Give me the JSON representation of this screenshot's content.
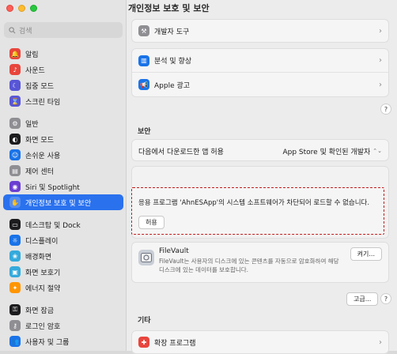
{
  "window": {
    "title": "개인정보 보호 및 보안"
  },
  "search": {
    "placeholder": "검색"
  },
  "sidebar": {
    "items": [
      {
        "label": "알림",
        "icon": "bell-icon",
        "color": "#e8453c",
        "glyph": "🔔"
      },
      {
        "label": "사운드",
        "icon": "speaker-icon",
        "color": "#e8453c",
        "glyph": "♪"
      },
      {
        "label": "집중 모드",
        "icon": "moon-icon",
        "color": "#5856d6",
        "glyph": "☾"
      },
      {
        "label": "스크린 타임",
        "icon": "hourglass-icon",
        "color": "#5856d6",
        "glyph": "⌛"
      },
      {
        "label": "일반",
        "icon": "gear-icon",
        "color": "#8e8e93",
        "glyph": "⚙"
      },
      {
        "label": "화면 모드",
        "icon": "appearance-icon",
        "color": "#1c1c1e",
        "glyph": "◐"
      },
      {
        "label": "손쉬운 사용",
        "icon": "accessibility-icon",
        "color": "#1a73e8",
        "glyph": "☺"
      },
      {
        "label": "제어 센터",
        "icon": "control-center-icon",
        "color": "#8e8e93",
        "glyph": "▤"
      },
      {
        "label": "Siri 및 Spotlight",
        "icon": "siri-icon",
        "color": "#6a3ed1",
        "glyph": "◉"
      },
      {
        "label": "개인정보 보호 및 보안",
        "icon": "hand-icon",
        "color": "#2a71ee",
        "glyph": "✋"
      },
      {
        "label": "데스크탑 및 Dock",
        "icon": "dock-icon",
        "color": "#1c1c1e",
        "glyph": "▭"
      },
      {
        "label": "디스플레이",
        "icon": "display-icon",
        "color": "#1a73e8",
        "glyph": "☼"
      },
      {
        "label": "배경화면",
        "icon": "wallpaper-icon",
        "color": "#34aadc",
        "glyph": "❀"
      },
      {
        "label": "화면 보호기",
        "icon": "screensaver-icon",
        "color": "#34aadc",
        "glyph": "▣"
      },
      {
        "label": "에너지 절약",
        "icon": "lightbulb-icon",
        "color": "#ff9500",
        "glyph": "✦"
      },
      {
        "label": "화면 잠금",
        "icon": "lock-screen-icon",
        "color": "#1c1c1e",
        "glyph": "⚿"
      },
      {
        "label": "로그인 암호",
        "icon": "login-password-icon",
        "color": "#8e8e93",
        "glyph": "⚷"
      },
      {
        "label": "사용자 및 그룹",
        "icon": "users-icon",
        "color": "#1a73e8",
        "glyph": "👥"
      }
    ]
  },
  "rows": {
    "developer_tools": "개발자 도구",
    "analytics": "분석 및 향상",
    "apple_ads": "Apple 광고"
  },
  "security": {
    "section_title": "보안",
    "allow_label": "다음에서 다운로드한 앱 허용",
    "allow_value": "App Store 및 확인된 개발자",
    "blocked_message": "응용 프로그램 'AhnESApp'의 시스템 소프트웨어가 차단되어 로드할 수 없습니다.",
    "allow_button": "허용",
    "filevault_title": "FileVault",
    "filevault_desc_1": "FileVault는 사용자의 디스크에 있는 콘텐츠를 자동으로 암호화하여 해당",
    "filevault_desc_2": "디스크에 있는 데이터를 보호합니다.",
    "turn_on_button": "켜기...",
    "advanced_button": "고급..."
  },
  "other": {
    "section_title": "기타",
    "extensions": "확장 프로그램"
  },
  "help_label": "?",
  "chevron": "›",
  "updown": "⌃⌄"
}
